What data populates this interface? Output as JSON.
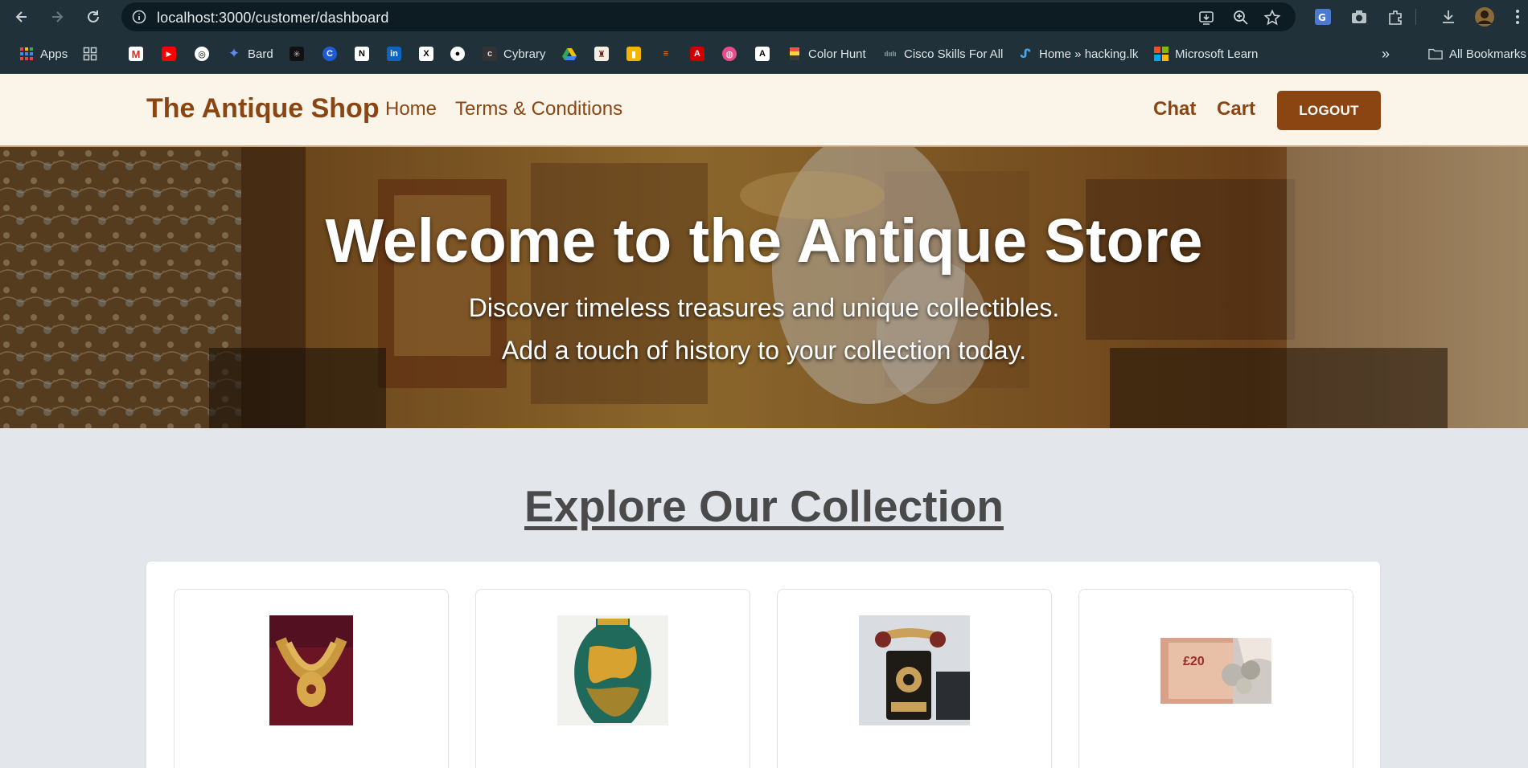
{
  "browser": {
    "url": "localhost:3000/customer/dashboard",
    "bookmarks": [
      {
        "label": "Apps",
        "icon": "apps-grid-icon"
      },
      {
        "label": "",
        "icon": "tab-groups-icon"
      },
      {
        "label": "",
        "icon": "gmail-icon"
      },
      {
        "label": "",
        "icon": "youtube-icon"
      },
      {
        "label": "",
        "icon": "chatgpt-icon"
      },
      {
        "label": "Bard",
        "icon": "bard-icon"
      },
      {
        "label": "",
        "icon": "perplexity-icon"
      },
      {
        "label": "",
        "icon": "c-icon"
      },
      {
        "label": "",
        "icon": "notion-icon"
      },
      {
        "label": "",
        "icon": "linkedin-icon"
      },
      {
        "label": "",
        "icon": "x-icon"
      },
      {
        "label": "",
        "icon": "github-icon"
      },
      {
        "label": "Cybrary",
        "icon": "cybrary-icon"
      },
      {
        "label": "",
        "icon": "google-drive-icon"
      },
      {
        "label": "",
        "icon": "university-icon"
      },
      {
        "label": "",
        "icon": "keep-icon"
      },
      {
        "label": "",
        "icon": "stackoverflow-icon"
      },
      {
        "label": "",
        "icon": "adobe-icon"
      },
      {
        "label": "",
        "icon": "dribbble-icon"
      },
      {
        "label": "",
        "icon": "a-icon"
      },
      {
        "label": "Color Hunt",
        "icon": "color-hunt-icon"
      },
      {
        "label": "Cisco Skills For All",
        "icon": "cisco-icon"
      },
      {
        "label": "Home » hacking.lk",
        "icon": "hacking-lk-icon"
      },
      {
        "label": "Microsoft Learn",
        "icon": "microsoft-icon"
      }
    ],
    "all_bookmarks_label": "All Bookmarks"
  },
  "header": {
    "brand": "The Antique Shop",
    "nav": [
      "Home",
      "Terms & Conditions"
    ],
    "right_links": [
      "Chat",
      "Cart"
    ],
    "logout_label": "LOGOUT"
  },
  "hero": {
    "title": "Welcome to the Antique Store",
    "line1": "Discover timeless treasures and unique collectibles.",
    "line2": "Add a touch of history to your collection today."
  },
  "collection": {
    "title": "Explore Our Collection",
    "products": [
      {
        "image": "necklace-image"
      },
      {
        "image": "vase-image"
      },
      {
        "image": "telephone-image"
      },
      {
        "image": "currency-image"
      }
    ]
  },
  "colors": {
    "brand": "#8b4513",
    "header_bg": "#faf5e8",
    "page_bg": "#e3e6ea",
    "chrome_bg": "#203139"
  }
}
